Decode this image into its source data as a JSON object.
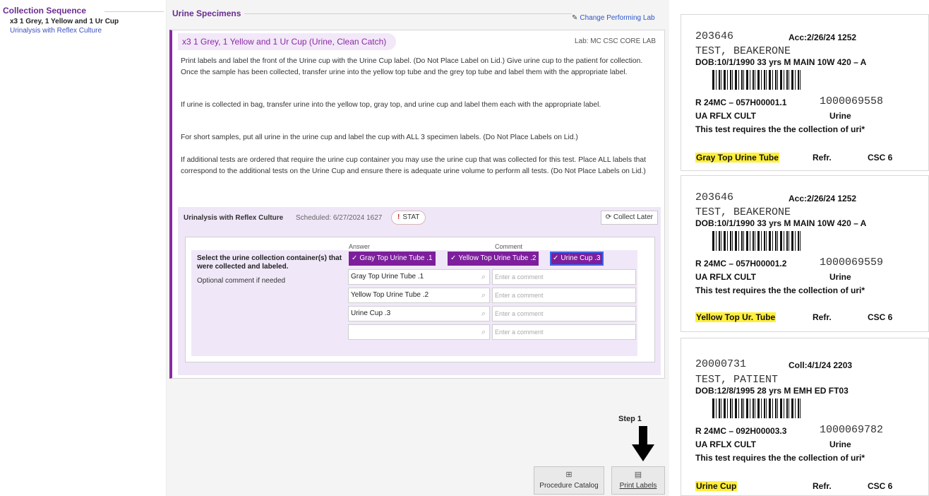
{
  "left_panel": {
    "title": "Collection Sequence",
    "item_current": "x3 1 Grey, 1 Yellow and 1 Ur Cup",
    "item_link": "Urinalysis with Reflex Culture"
  },
  "main": {
    "title": "Urine Specimens",
    "change_lab": "Change Performing Lab",
    "card": {
      "header": "x3 1 Grey, 1 Yellow and 1 Ur Cup (Urine, Clean Catch)",
      "lab": "Lab: MC CSC CORE LAB",
      "paragraphs": [
        "Print labels and label the front of the Urine cup with the Urine Cup label. (Do Not Place Label on Lid.) Give urine cup to the patient for collection. Once the sample has been collected, transfer urine into the yellow top tube and the grey top tube and label them with the appropriate label.",
        "If urine is collected in bag, transfer urine into the yellow top, gray top, and urine cup and label them each with the appropriate label.",
        "For short samples, put all urine in the urine cup and label the cup with ALL 3 specimen labels. (Do Not Place Labels on Lid.)",
        "If additional tests are ordered that require the urine cup container you may use the urine cup that was collected for this test. Place ALL labels that correspond to the additional tests on the Urine Cup and ensure there is adequate urine volume to perform all tests. (Do Not Place Labels on Lid.)"
      ]
    },
    "culture": {
      "title": "Urinalysis with Reflex Culture",
      "scheduled": "Scheduled: 6/27/2024 1627",
      "stat_icon": "!",
      "stat": "STAT",
      "collect_later": "Collect Later",
      "header_answer": "Answer",
      "header_comment": "Comment",
      "question": "Select the urine collection container(s) that were collected and labeled.",
      "optional": "Optional comment if needed",
      "chips": [
        "Gray Top Urine Tube .1",
        "Yellow Top Urine Tube .2",
        "Urine Cup .3"
      ],
      "answers": [
        "Gray Top Urine Tube .1",
        "Yellow Top Urine Tube .2",
        "Urine Cup .3",
        ""
      ],
      "comment_placeholder": "Enter a comment"
    },
    "step_label": "Step 1",
    "buttons": {
      "procedure_catalog": "Procedure Catalog",
      "print_labels": "Print Labels"
    }
  },
  "labels": [
    {
      "id": "203646",
      "acc": "Acc:2/26/24 1252",
      "name": "TEST, BEAKERONE",
      "dob": "DOB:10/1/1990     33 yrs   M  MAIN 10W    420 – A",
      "spec": "R  24MC – 057H00001.1",
      "num": "1000069558",
      "test": "UA RFLX CULT",
      "type": "Urine",
      "req": "This test requires the the collection of uri*",
      "tube": "Gray Top Urine Tube",
      "refr": "Refr.",
      "csc": "CSC 6"
    },
    {
      "id": "203646",
      "acc": "Acc:2/26/24 1252",
      "name": "TEST, BEAKERONE",
      "dob": "DOB:10/1/1990     33 yrs   M  MAIN 10W    420 – A",
      "spec": "R  24MC – 057H00001.2",
      "num": "1000069559",
      "test": "UA RFLX CULT",
      "type": "Urine",
      "req": "This test requires the the collection of uri*",
      "tube": "Yellow Top Ur. Tube",
      "refr": "Refr.",
      "csc": "CSC 6"
    },
    {
      "id": "20000731",
      "acc": "Coll:4/1/24 2203",
      "name": "TEST, PATIENT",
      "dob": "DOB:12/8/1995     28 yrs   M  EMH ED         FT03",
      "spec": "R  24MC – 092H00003.3",
      "num": "1000069782",
      "test": "UA RFLX CULT",
      "type": "Urine",
      "req": "This test requires the the collection of uri*",
      "tube": "Urine Cup",
      "refr": "Refr.",
      "csc": "CSC 6"
    }
  ]
}
